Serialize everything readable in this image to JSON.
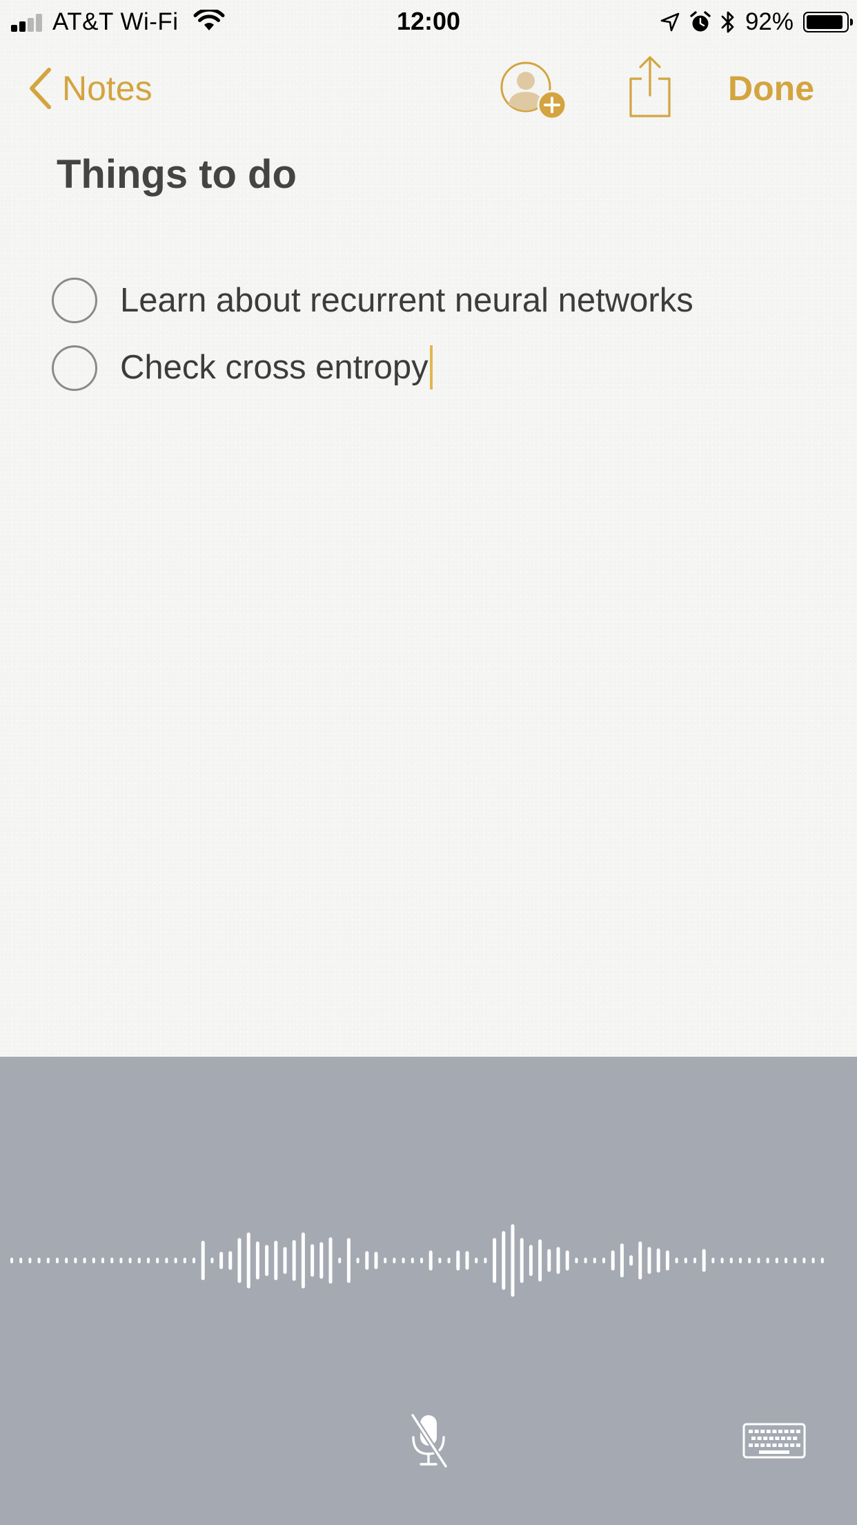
{
  "status_bar": {
    "carrier": "AT&T Wi-Fi",
    "time": "12:00",
    "battery_percent": "92%",
    "battery_level": 0.92,
    "signal_bars_filled": 2,
    "signal_bars_total": 4,
    "icons": [
      "signal-bars-icon",
      "wifi-icon",
      "location-arrow-icon",
      "alarm-clock-icon",
      "bluetooth-icon",
      "battery-icon"
    ]
  },
  "nav": {
    "back_label": "Notes",
    "done_label": "Done",
    "icons": [
      "chevron-left-icon",
      "add-people-icon",
      "share-icon"
    ]
  },
  "note": {
    "title": "Things to do",
    "items": [
      {
        "text": "Learn about recurrent neural networks",
        "checked": false
      },
      {
        "text": "Check cross entropy",
        "checked": false
      }
    ]
  },
  "dictation": {
    "icons": [
      "waveform-icon",
      "microphone-muted-icon",
      "keyboard-icon"
    ]
  },
  "colors": {
    "accent": "#d3a43f",
    "paper": "#f5f5f3",
    "text": "#3c3c3c",
    "title_text": "#444444",
    "dictation_bg": "#a5a9b2",
    "cursor": "#e0b84c"
  }
}
